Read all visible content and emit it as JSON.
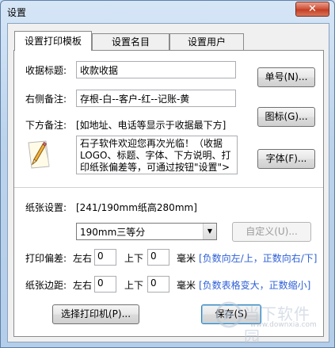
{
  "window": {
    "title": "设置",
    "close_glyph": "✕"
  },
  "tabs": [
    {
      "label": "设置打印模板",
      "active": true
    },
    {
      "label": "设置名目",
      "active": false
    },
    {
      "label": "设置用户",
      "active": false
    }
  ],
  "form": {
    "receipt_title_label": "收据标题:",
    "receipt_title_value": "收款收据",
    "right_note_label": "右侧备注:",
    "right_note_value": "存根-白--客户-红--记账-黄",
    "bottom_note_label": "下方备注:",
    "bottom_note_hint": "[如地址、电话等显示于收据最下方]",
    "bottom_note_value": "石子软件欢迎您再次光临！（收据LOGO、标题、字体、下方说明、打印纸张偏差等，可通过按钮\"设置\">",
    "paper_label": "纸张设置:",
    "paper_info": "[241/190mm纸高280mm]",
    "paper_select_value": "190mm三等分",
    "print_offset_label": "打印偏差:",
    "margin_label": "纸张边距:",
    "lr_label": "左右",
    "ud_label": "上下",
    "unit_mm": "毫米",
    "offset_lr": "0",
    "offset_ud": "0",
    "margin_lr": "0",
    "margin_ud": "0",
    "offset_hint": "[负数向左/上，正数向右/下]",
    "margin_hint": "[负数表格变大，正数缩小]"
  },
  "buttons": {
    "number": "单号(N)...",
    "icon": "图标(G)...",
    "font": "字体(F)...",
    "custom": "自定义(U)...",
    "select_printer": "选择打印机(P)...",
    "save": "保存(S)"
  },
  "watermark": {
    "cn": "当下软件园",
    "en": "www.downxia.com"
  }
}
